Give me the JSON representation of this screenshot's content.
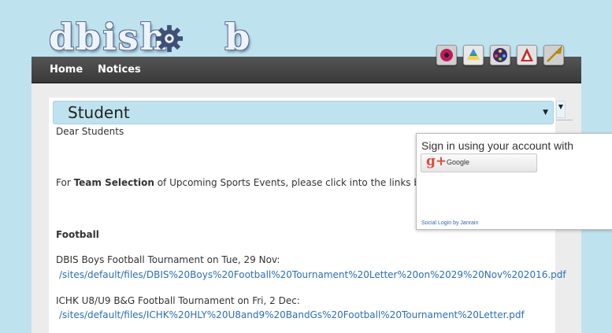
{
  "site": {
    "logo_text": "dbish b"
  },
  "nav": {
    "items": [
      {
        "label": "Home"
      },
      {
        "label": "Notices"
      }
    ]
  },
  "app_icons": [
    "flower-app-icon",
    "google-drive-icon",
    "film-reel-icon",
    "acrobat-icon",
    "trumpet-icon"
  ],
  "selector": {
    "value": "Student"
  },
  "body": {
    "greeting": "Dear Students",
    "intro_before": "For ",
    "intro_bold": "Team Selection",
    "intro_after": " of Upcoming Sports Events, please click into the links below",
    "section_heading": "Football",
    "events": [
      {
        "title": "DBIS Boys Football Tournament on Tue, 29 Nov:",
        "link": "/sites/default/files/DBIS%20Boys%20Football%20Tournament%20Letter%20on%2029%20Nov%202016.pdf"
      },
      {
        "title": "ICHK U8/U9 B&G Football Tournament on Fri, 2 Dec:",
        "link": "/sites/default/files/ICHK%20HLY%20U8and9%20BandGs%20Football%20Tournament%20Letter.pdf"
      }
    ]
  },
  "signin_popup": {
    "title": "Sign in using your account with",
    "google_label": "Google",
    "footer": "Social Login by Janrain"
  },
  "colors": {
    "background": "#bfe3ee",
    "nav": "#3a3a3a",
    "link": "#2a6fb8"
  }
}
